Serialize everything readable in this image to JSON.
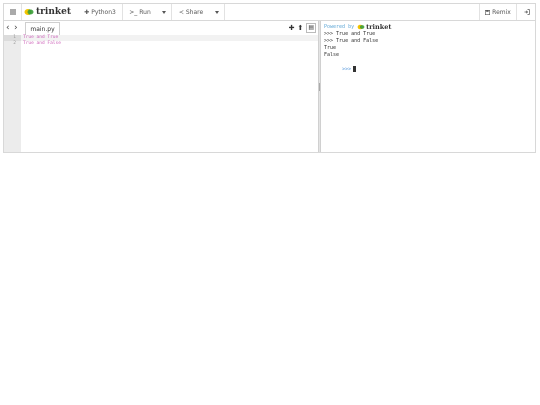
{
  "toolbar": {
    "menu_icon": "hamburger-icon",
    "brand": "trinket",
    "language": "Python3",
    "run_label": "Run",
    "run_prefix": ">_",
    "share_label": "Share",
    "remix_label": "Remix"
  },
  "editor": {
    "file_tab": "main.py",
    "line_numbers": [
      "1",
      "2"
    ],
    "lines": [
      "True and True",
      "True and False"
    ]
  },
  "console": {
    "powered_by": "Powered by",
    "brand": "trinket",
    "lines": [
      ">>> True and True",
      ">>> True and False",
      "True",
      "False"
    ],
    "prompt": ">>>"
  },
  "colors": {
    "brand_yellow": "#f2c300",
    "brand_green": "#3c9e3a",
    "code_text": "#cc5fb8",
    "prompt": "#4a90d9"
  }
}
